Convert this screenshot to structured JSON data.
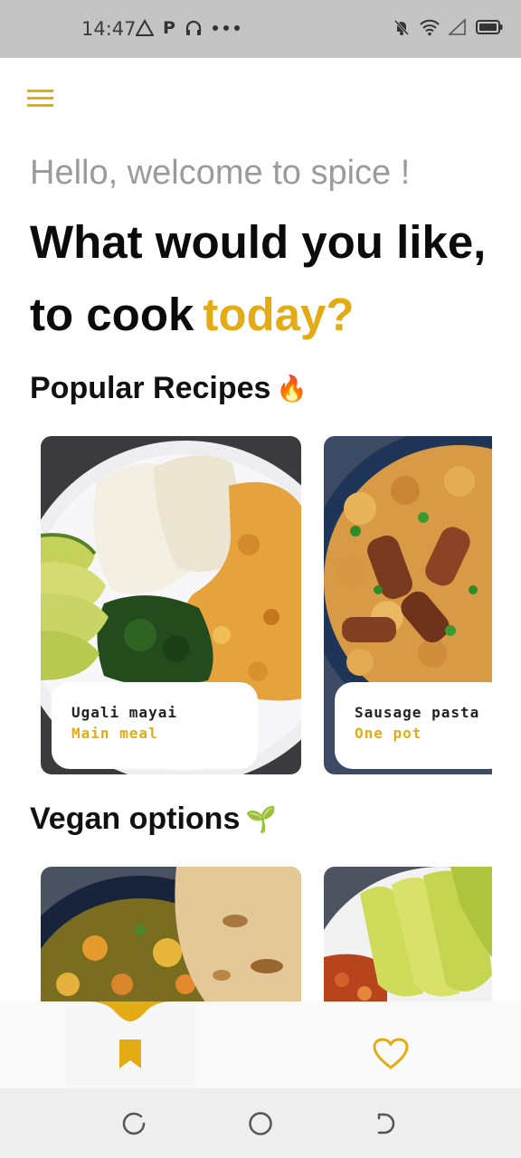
{
  "status_bar": {
    "time": "14:47",
    "left_icons": [
      "alert-triangle-icon",
      "parking-icon",
      "headphones-icon",
      "more-dots-icon"
    ],
    "right_icons": [
      "bell-off-icon",
      "wifi-icon",
      "signal-icon",
      "battery-icon"
    ]
  },
  "header": {
    "greeting": "Hello, welcome to spice !",
    "headline_line1": "What would you like,",
    "headline_line2_prefix": "to cook",
    "headline_line2_accent": "today?"
  },
  "sections": {
    "popular": {
      "title": "Popular Recipes",
      "emoji": "🔥",
      "cards": [
        {
          "name": "Ugali mayai",
          "category": "Main meal",
          "image": "ugali-eggs-avocado-photo"
        },
        {
          "name": "Sausage pasta",
          "category": "One pot",
          "image": "sausage-pasta-photo"
        }
      ]
    },
    "vegan": {
      "title": "Vegan options",
      "emoji": "🌱",
      "cards": [
        {
          "image": "lentil-stew-chapati-photo"
        },
        {
          "image": "avocado-beans-photo"
        }
      ]
    }
  },
  "bottom_nav": {
    "items": [
      {
        "icon": "bookmark-icon",
        "active": true
      },
      {
        "icon": "heart-icon",
        "active": false
      }
    ]
  },
  "system_nav": [
    "back-icon",
    "home-icon",
    "recent-apps-icon"
  ],
  "colors": {
    "accent": "#e4ac14",
    "heading": "#0b0b0b",
    "greeting": "#9b9b9b",
    "status_bar_bg": "#c4c4c4"
  }
}
